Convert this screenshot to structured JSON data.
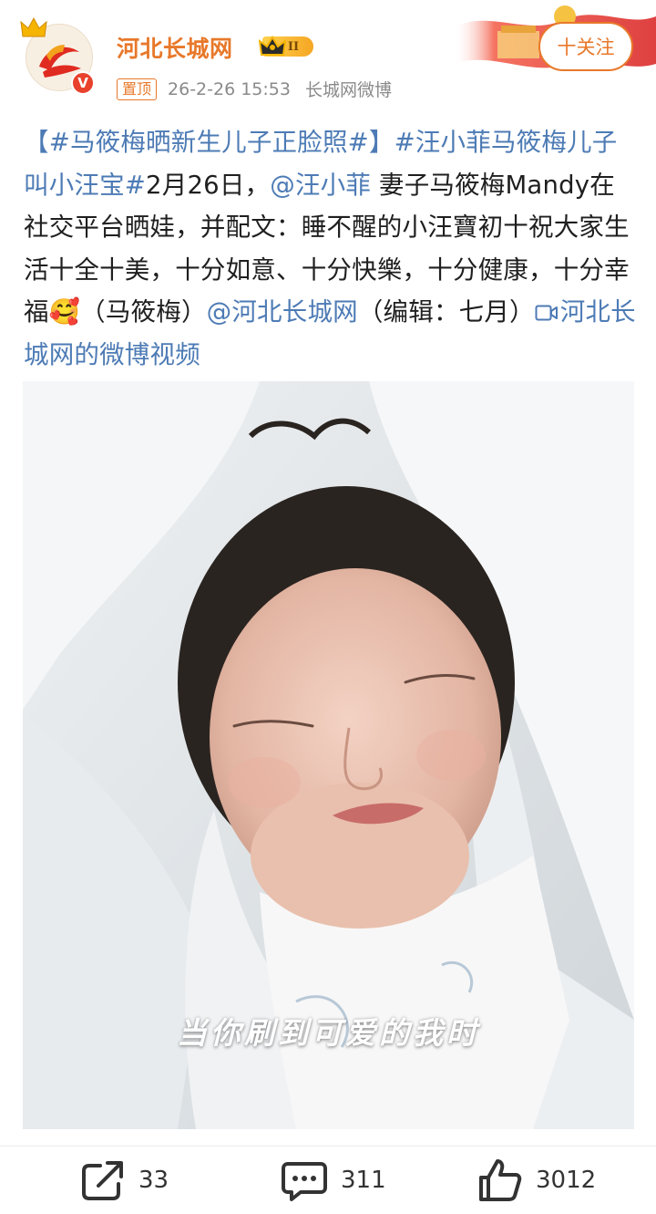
{
  "post": {
    "user_name": "河北长城网",
    "level": "II",
    "pinned_label": "置顶",
    "timestamp": "26-2-26 15:53",
    "source": "长城网微博",
    "follow_label": "十关注",
    "text": {
      "hashtag1": "【#马筱梅晒新生儿子正脸照#】",
      "hashtag2": "#汪小菲马筱梅儿子叫小汪宝#",
      "date_text": "2月26日，",
      "mention1": "@汪小菲",
      "body": " 妻子马筱梅Mandy在社交平台晒娃，并配文：睡不醒的小汪寶初十祝大家生活十全十美，十分如意、十分快樂，十分健康，十分幸福",
      "emoji": "🥰",
      "credit": "（马筱梅）",
      "mention2": "@河北长城网",
      "editor": "（编辑：七月）",
      "video_link": "河北长城网的微博视频"
    },
    "image_caption": "当你刷到可爱的我时"
  },
  "actions": {
    "reposts": "33",
    "comments": "311",
    "likes": "3012"
  },
  "colors": {
    "accent": "#e8782a",
    "link": "#4d7bb5",
    "verified": "#e8412c"
  }
}
